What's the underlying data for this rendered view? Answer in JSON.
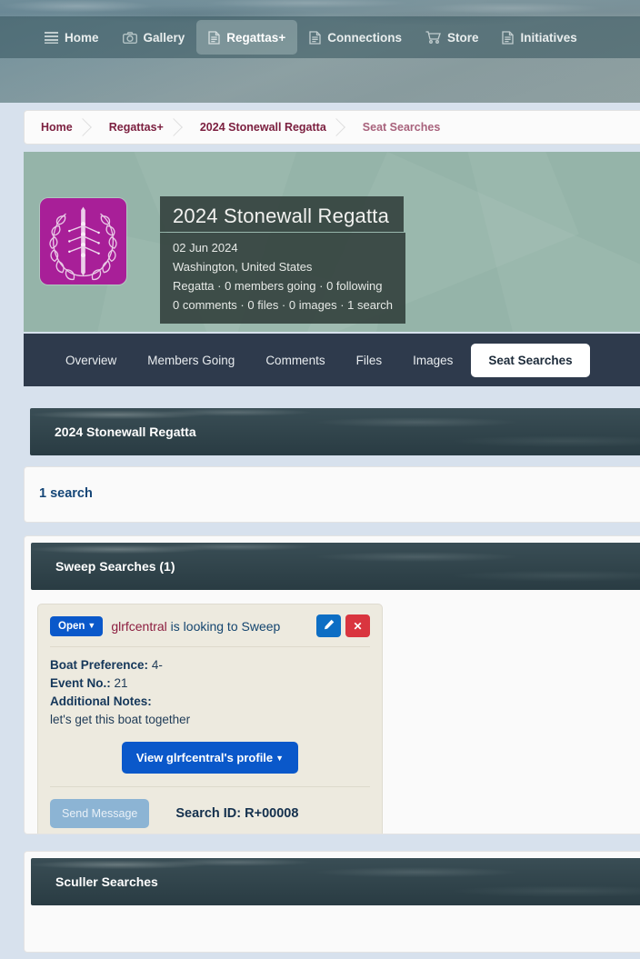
{
  "nav": {
    "items": [
      {
        "label": "Home",
        "icon": "list-icon",
        "active": false
      },
      {
        "label": "Gallery",
        "icon": "camera-icon",
        "active": false
      },
      {
        "label": "Regattas+",
        "icon": "document-icon",
        "active": true
      },
      {
        "label": "Connections",
        "icon": "document-icon",
        "active": false
      },
      {
        "label": "Store",
        "icon": "cart-icon",
        "active": false
      },
      {
        "label": "Initiatives",
        "icon": "document-icon",
        "active": false
      }
    ]
  },
  "breadcrumb": {
    "items": [
      {
        "label": "Home"
      },
      {
        "label": "Regattas+"
      },
      {
        "label": "2024 Stonewall Regatta"
      },
      {
        "label": "Seat Searches"
      }
    ]
  },
  "hero": {
    "title": "2024 Stonewall Regatta",
    "date": "02 Jun 2024",
    "location": "Washington, United States",
    "stats_line1": "Regatta · 0 members going · 0 following",
    "stats_line2": "0 comments · 0 files  · 0 images  · 1 search",
    "logo_color": "#a81f98",
    "banner_color": "#8fb0a4"
  },
  "tabs": [
    {
      "label": "Overview",
      "active": false
    },
    {
      "label": "Members Going",
      "active": false
    },
    {
      "label": "Comments",
      "active": false
    },
    {
      "label": "Files",
      "active": false
    },
    {
      "label": "Images",
      "active": false
    },
    {
      "label": "Seat Searches",
      "active": true
    }
  ],
  "panels": {
    "regatta_header": "2024 Stonewall Regatta",
    "search_count": "1 search",
    "sweep_header": "Sweep Searches (1)",
    "sculler_header": "Sculler Searches"
  },
  "search_card": {
    "status_label": "Open",
    "user": "glrfcentral",
    "title_rest": " is looking to Sweep",
    "edit_icon": "pencil-icon",
    "delete_icon": "close-icon",
    "boat_preference_label": "Boat Preference:",
    "boat_preference_value": "4-",
    "event_no_label": "Event No.:",
    "event_no_value": "21",
    "notes_label": "Additional Notes:",
    "notes_value": "let's get this boat together",
    "profile_button": "View glrfcentral's profile",
    "send_message_button": "Send Message",
    "search_id": "Search ID: R+00008",
    "accent_blue": "#0a58ca",
    "danger_red": "#d9353f",
    "card_bg": "#edeadf"
  }
}
